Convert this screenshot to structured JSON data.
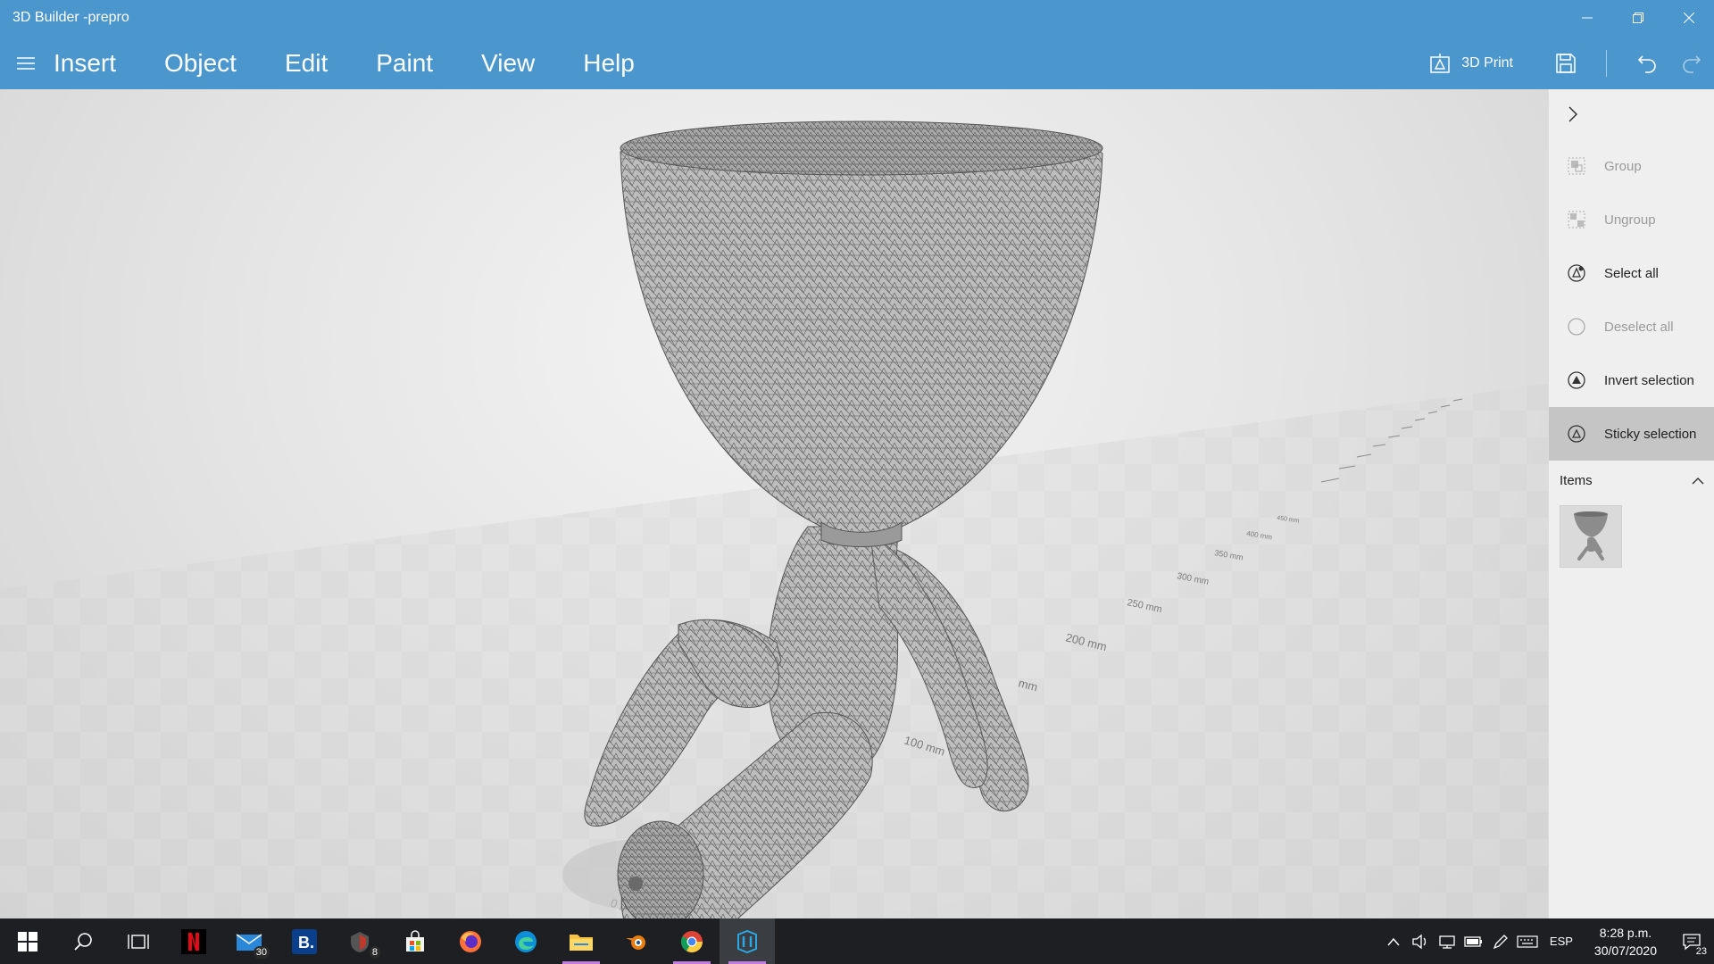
{
  "window": {
    "title": "3D Builder -prepro"
  },
  "menu": [
    {
      "label": "Insert"
    },
    {
      "label": "Object"
    },
    {
      "label": "Edit"
    },
    {
      "label": "Paint"
    },
    {
      "label": "View"
    },
    {
      "label": "Help"
    }
  ],
  "toolbar": {
    "print_label": "3D Print"
  },
  "panel": {
    "items": [
      {
        "label": "Group",
        "icon": "group-icon",
        "state": "disabled"
      },
      {
        "label": "Ungroup",
        "icon": "ungroup-icon",
        "state": "disabled"
      },
      {
        "label": "Select all",
        "icon": "select-all-icon",
        "state": "enabled"
      },
      {
        "label": "Deselect all",
        "icon": "deselect-all-icon",
        "state": "disabled"
      },
      {
        "label": "Invert selection",
        "icon": "invert-selection-icon",
        "state": "enabled"
      },
      {
        "label": "Sticky selection",
        "icon": "sticky-selection-icon",
        "state": "active"
      }
    ],
    "items_header": "Items"
  },
  "viewport": {
    "ruler_labels": [
      "0 mm",
      "mm",
      "100 mm",
      "mm",
      "200 mm",
      "250 mm",
      "300 mm",
      "350 mm",
      "400 mm",
      "450 mm"
    ]
  },
  "taskbar": {
    "apps": [
      "netflix",
      "mail",
      "booking",
      "antivirus",
      "store",
      "firefox",
      "edge",
      "file-explorer",
      "blender",
      "chrome",
      "3d-builder"
    ],
    "mail_badge": "30",
    "antivirus_badge": "8",
    "language": "ESP",
    "time": "8:28 p.m.",
    "date": "30/07/2020",
    "notifications": "23"
  },
  "colors": {
    "titlebar": "#4a96cd",
    "panel": "#efefef",
    "panel_active": "#c5c5c5",
    "taskbar": "#1d1f22"
  }
}
